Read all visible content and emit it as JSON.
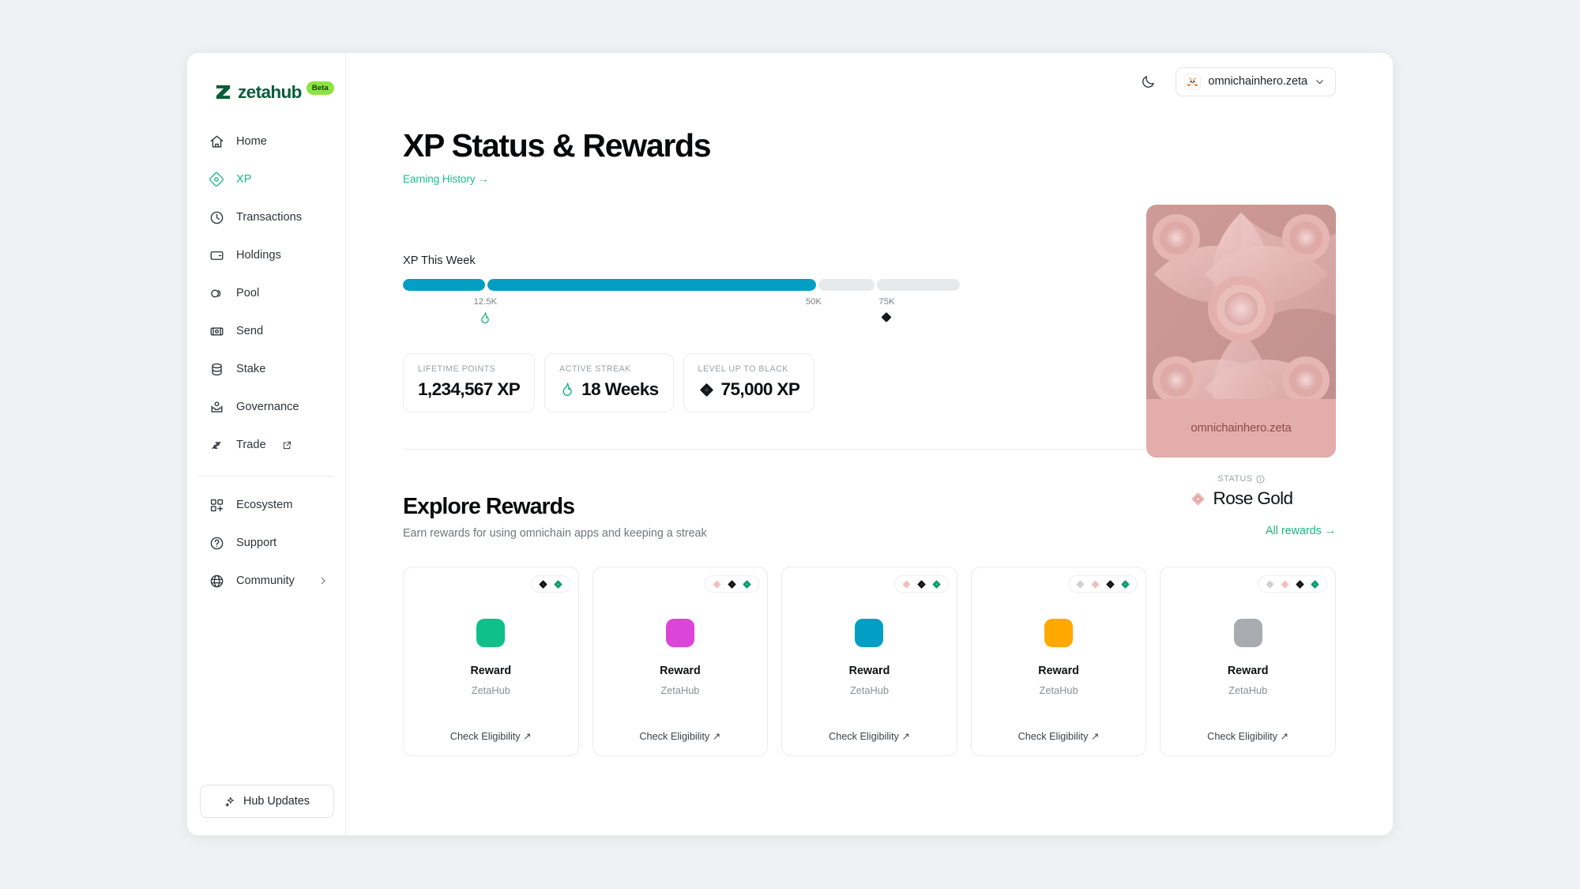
{
  "brand": {
    "name": "zetahub",
    "badge": "Beta"
  },
  "sidebar": {
    "items": [
      {
        "label": "Home",
        "icon": "home-icon",
        "active": false
      },
      {
        "label": "XP",
        "icon": "diamond-xp-icon",
        "active": true
      },
      {
        "label": "Transactions",
        "icon": "clock-icon",
        "active": false
      },
      {
        "label": "Holdings",
        "icon": "card-icon",
        "active": false
      },
      {
        "label": "Pool",
        "icon": "pool-circles-icon",
        "active": false
      },
      {
        "label": "Send",
        "icon": "send-bill-icon",
        "active": false
      },
      {
        "label": "Stake",
        "icon": "stake-database-icon",
        "active": false
      },
      {
        "label": "Governance",
        "icon": "governance-inbox-icon",
        "active": false
      },
      {
        "label": "Trade",
        "icon": "trade-arrows-icon",
        "external": true,
        "active": false
      }
    ],
    "secondary": [
      {
        "label": "Ecosystem",
        "icon": "grid-plus-icon"
      },
      {
        "label": "Support",
        "icon": "question-circle-icon"
      },
      {
        "label": "Community",
        "icon": "globe-icon",
        "chevron": true
      }
    ],
    "hub_updates": {
      "label": "Hub Updates",
      "icon": "sparkle-icon"
    }
  },
  "topbar": {
    "theme_toggle_icon": "moon-icon",
    "wallet": {
      "icon": "metamask-fox-icon",
      "name": "omnichainhero.zeta",
      "chevron": "chevron-down-icon"
    }
  },
  "header": {
    "title": "XP Status & Rewards",
    "earning_history": "Earning History →"
  },
  "xp_week": {
    "label": "XP This Week",
    "segments": [
      {
        "width_pct": 15,
        "fill_pct": 100
      },
      {
        "width_pct": 59.7,
        "fill_pct": 100
      },
      {
        "width_pct": 10.2,
        "fill_pct": 0
      },
      {
        "width_pct": 15.1,
        "fill_pct": 0
      }
    ],
    "ticks": [
      {
        "label": "12.5K",
        "pos_pct": 15,
        "icon": "flame-icon",
        "icon_color": "#17b97f"
      },
      {
        "label": "50K",
        "pos_pct": 74.7,
        "icon": null
      },
      {
        "label": "75K",
        "pos_pct": 88.0,
        "icon": "black-diamond-icon",
        "icon_color": "#16181a"
      }
    ]
  },
  "stats": [
    {
      "label": "LIFETIME POINTS",
      "value": "1,234,567 XP",
      "icon": null
    },
    {
      "label": "ACTIVE STREAK",
      "value": "18 Weeks",
      "icon": "flame-icon"
    },
    {
      "label": "LEVEL UP TO BLACK",
      "value": "75,000 XP",
      "icon": "black-diamond-icon"
    }
  ],
  "nft": {
    "name": "omnichainhero.zeta",
    "status_label": "STATUS",
    "status_info_icon": "info-icon",
    "status_value": "Rose Gold",
    "status_icon": "rose-gold-diamond-icon",
    "card_color": "#d9a5a2"
  },
  "rewards": {
    "title": "Explore Rewards",
    "subtitle": "Earn rewards for using omnichain apps and keeping a streak",
    "all_link": "All rewards →",
    "cta": "Check Eligibility ↗",
    "cards": [
      {
        "name": "Reward",
        "source": "ZetaHub",
        "color": "#0fc08a",
        "tiers": [
          "black",
          "green"
        ]
      },
      {
        "name": "Reward",
        "source": "ZetaHub",
        "color": "#dd44d8",
        "tiers": [
          "rose",
          "black",
          "green"
        ]
      },
      {
        "name": "Reward",
        "source": "ZetaHub",
        "color": "#029ec4",
        "tiers": [
          "rose",
          "black",
          "green"
        ]
      },
      {
        "name": "Reward",
        "source": "ZetaHub",
        "color": "#ffa800",
        "tiers": [
          "silver",
          "rose",
          "black",
          "green"
        ]
      },
      {
        "name": "Reward",
        "source": "ZetaHub",
        "color": "#a8abaf",
        "tiers": [
          "silver",
          "rose",
          "black",
          "green"
        ]
      }
    ]
  },
  "colors": {
    "brand_green": "#0b5c3b",
    "accent_green": "#17b97f",
    "progress_blue": "#029ec4",
    "beta_badge": "#8de33f"
  }
}
